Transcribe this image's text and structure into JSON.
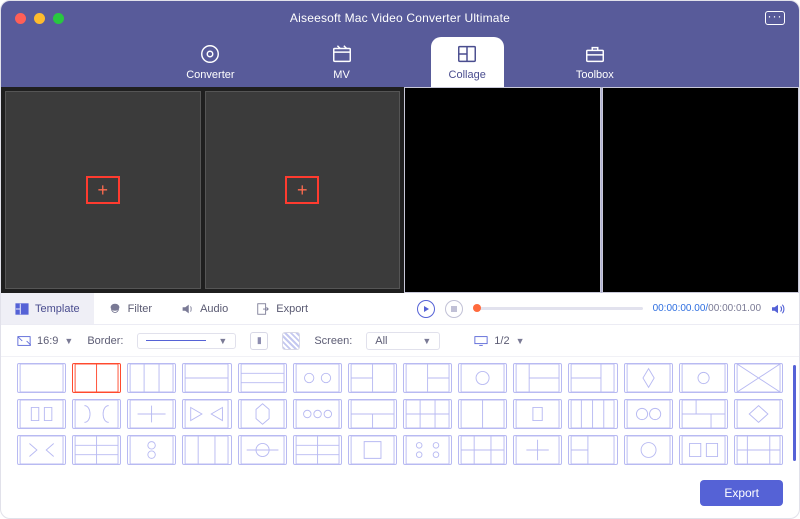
{
  "title": "Aiseesoft Mac Video Converter Ultimate",
  "nav": {
    "items": [
      "Converter",
      "MV",
      "Collage",
      "Toolbox"
    ],
    "active": 2
  },
  "tabs": {
    "items": [
      "Template",
      "Filter",
      "Audio",
      "Export"
    ],
    "active": 0
  },
  "player": {
    "elapsed": "00:00:00.00",
    "total": "00:00:01.00"
  },
  "controls": {
    "ratio": "16:9",
    "border_label": "Border:",
    "screen_label": "Screen:",
    "screen_value": "All",
    "page": "1/2"
  },
  "export_label": "Export",
  "layout_count": 42,
  "selected_layout_index": 1
}
